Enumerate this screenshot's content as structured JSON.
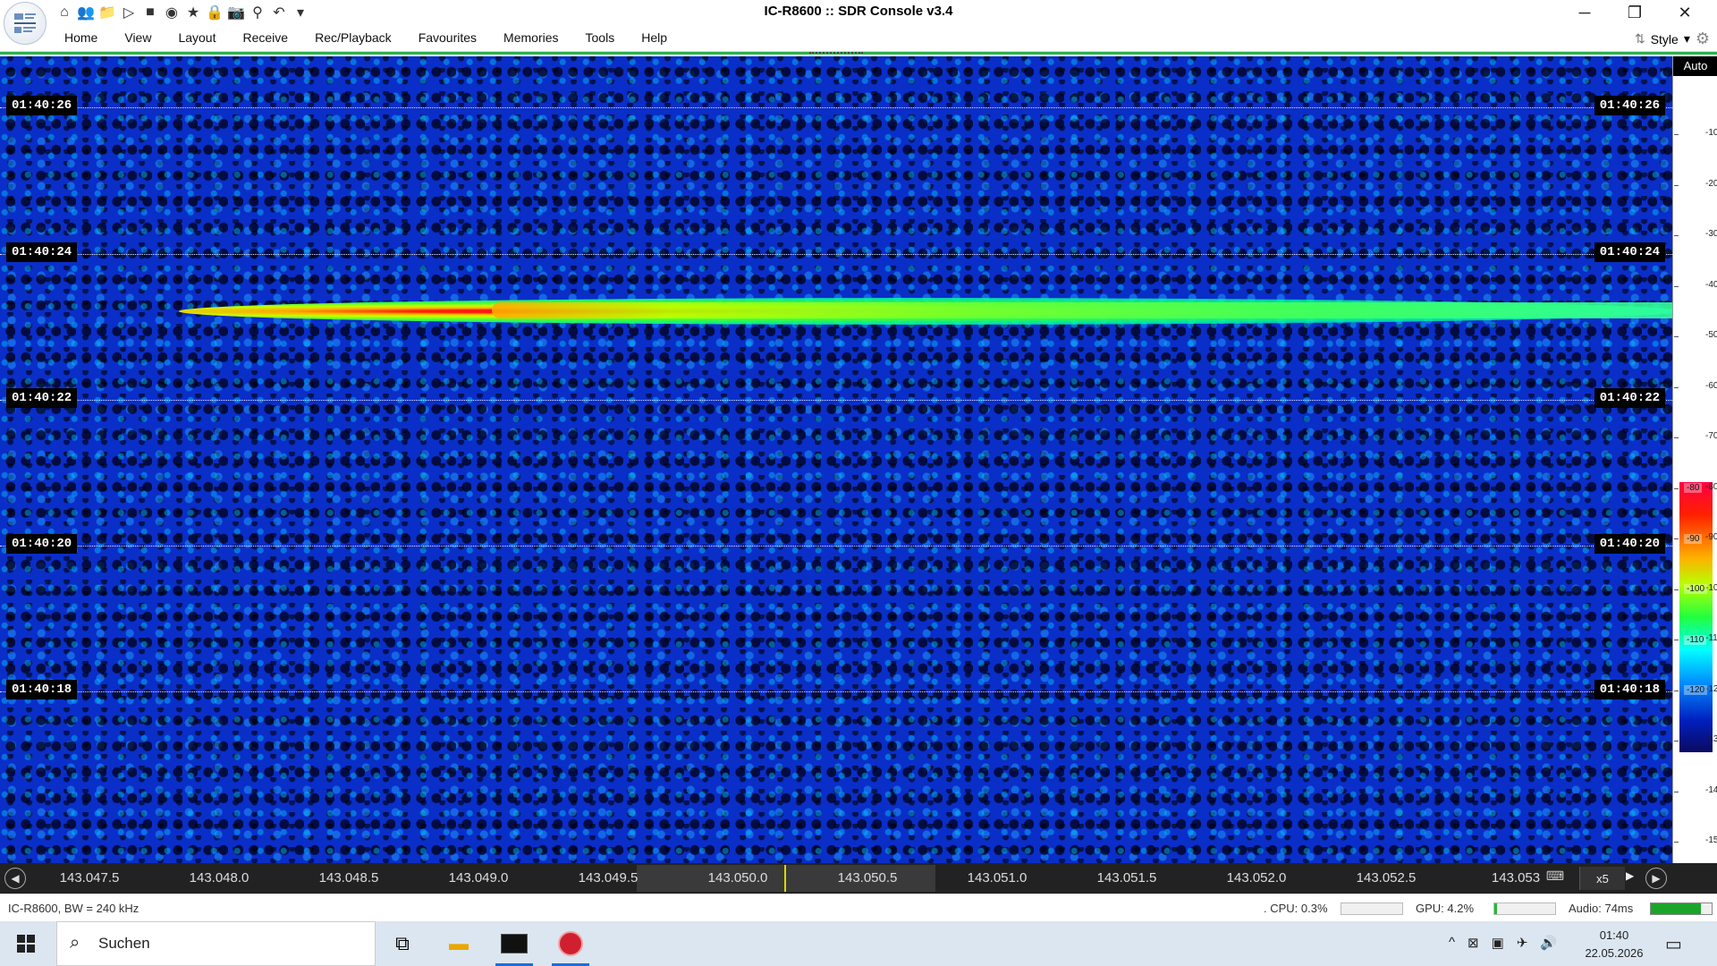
{
  "window": {
    "title": "IC-R8600 :: SDR Console v3.4",
    "controls": {
      "minimize": "─",
      "restore": "❐",
      "close": "✕"
    }
  },
  "quick_access": [
    {
      "name": "home-icon",
      "glyph": "⌂"
    },
    {
      "name": "users-icon",
      "glyph": "👥"
    },
    {
      "name": "folder-icon",
      "glyph": "📁"
    },
    {
      "name": "play-icon",
      "glyph": "▷"
    },
    {
      "name": "stop-icon",
      "glyph": "■"
    },
    {
      "name": "radio-icon",
      "glyph": "◉"
    },
    {
      "name": "star-icon",
      "glyph": "★"
    },
    {
      "name": "lock-icon",
      "glyph": "🔒"
    },
    {
      "name": "camera-icon",
      "glyph": "📷"
    },
    {
      "name": "antenna-icon",
      "glyph": "⚲"
    },
    {
      "name": "undo-icon",
      "glyph": "↶"
    },
    {
      "name": "customize-icon",
      "glyph": "▾"
    }
  ],
  "menu": [
    "Home",
    "View",
    "Layout",
    "Receive",
    "Rec/Playback",
    "Favourites",
    "Memories",
    "Tools",
    "Help"
  ],
  "style_menu": {
    "label": "Style",
    "arrow": "▾"
  },
  "waterfall": {
    "time_labels": [
      "01:40:26",
      "01:40:24",
      "01:40:22",
      "01:40:20",
      "01:40:18"
    ]
  },
  "db_scale": {
    "auto_label": "Auto",
    "ticks": [
      "-10",
      "-20",
      "-30",
      "-40",
      "-50",
      "-60",
      "-70",
      "-80",
      "-90",
      "-100",
      "-110",
      "-120",
      "-130",
      "-140",
      "-150"
    ],
    "bar_labels": [
      "-80",
      "-90",
      "-100",
      "-110",
      "-120"
    ]
  },
  "freq_axis": {
    "labels": [
      "143.047.5",
      "143.048.0",
      "143.048.5",
      "143.049.0",
      "143.049.5",
      "143.050.0",
      "143.050.5",
      "143.051.0",
      "143.051.5",
      "143.052.0",
      "143.052.5",
      "143.053"
    ],
    "zoom": "x5",
    "left_button": "◀",
    "right_button": "▶",
    "keyboard_glyph": "⌨"
  },
  "status": {
    "left": "IC-R8600, BW = 240 kHz",
    "cpu": ". CPU: 0.3%",
    "cpu_load": 0.003,
    "gpu": "GPU: 4.2%",
    "gpu_load": 0.042,
    "audio": "Audio: 74ms",
    "audio_level": 0.82
  },
  "taskbar": {
    "search_placeholder": "Suchen",
    "clock_time": "01:40",
    "clock_date": "22.05.2026",
    "tray": [
      "^",
      "⊠",
      "▣",
      "✈",
      "🔊"
    ]
  },
  "colors": {
    "accent": "#2bb24c",
    "waterfall_bg": "#0a2ec8",
    "signal_peak": "#ff0066"
  }
}
